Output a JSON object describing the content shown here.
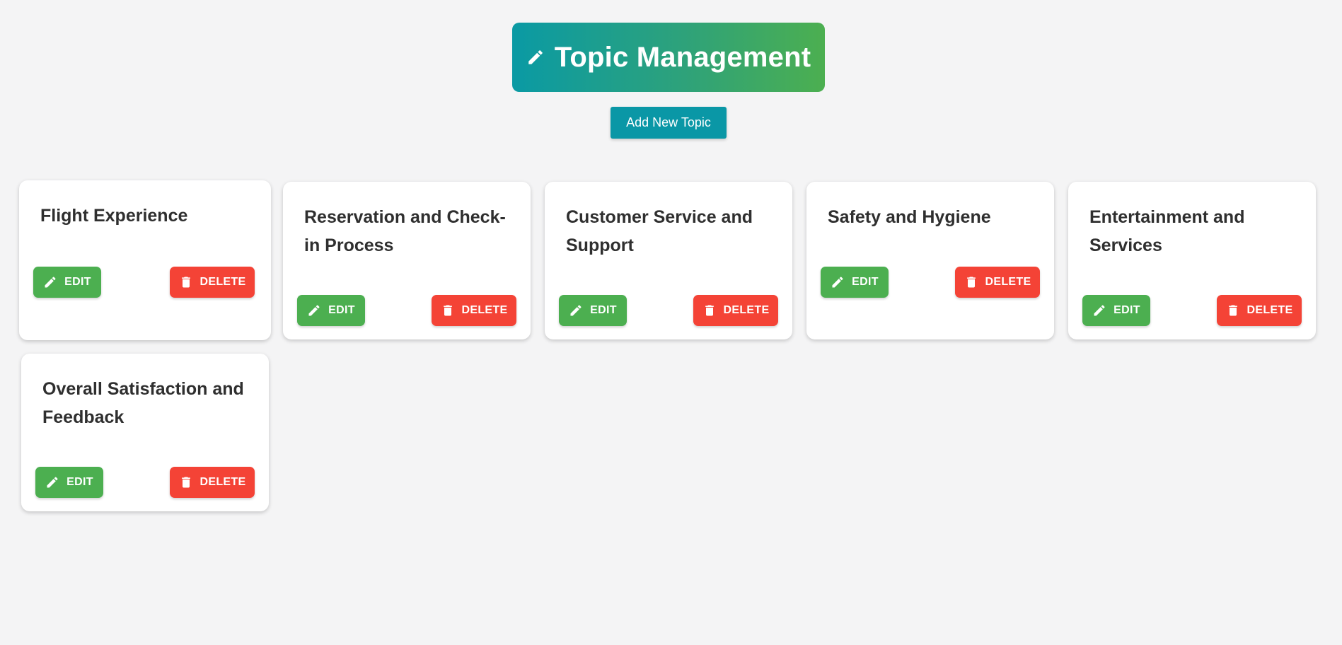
{
  "header": {
    "title": "Topic Management",
    "title_icon": "pencil-icon"
  },
  "toolbar": {
    "add_label": "Add New Topic"
  },
  "card_actions": {
    "edit_label": "EDIT",
    "edit_icon": "pencil-icon",
    "delete_label": "DELETE",
    "delete_icon": "trash-icon"
  },
  "topics": [
    {
      "title": "Flight Experience"
    },
    {
      "title": "Reservation and Check-in Process"
    },
    {
      "title": "Customer Service and Support"
    },
    {
      "title": "Safety and Hygiene"
    },
    {
      "title": "Entertainment and Services"
    },
    {
      "title": "Overall Satisfaction and Feedback"
    }
  ],
  "colors": {
    "background": "#f4f4f5",
    "banner_gradient_start": "#0a9aa4",
    "banner_gradient_end": "#4caf50",
    "add_button": "#0a97a6",
    "edit_button": "#4caf50",
    "delete_button": "#f44336",
    "card_title_text": "#2f2f2f"
  }
}
